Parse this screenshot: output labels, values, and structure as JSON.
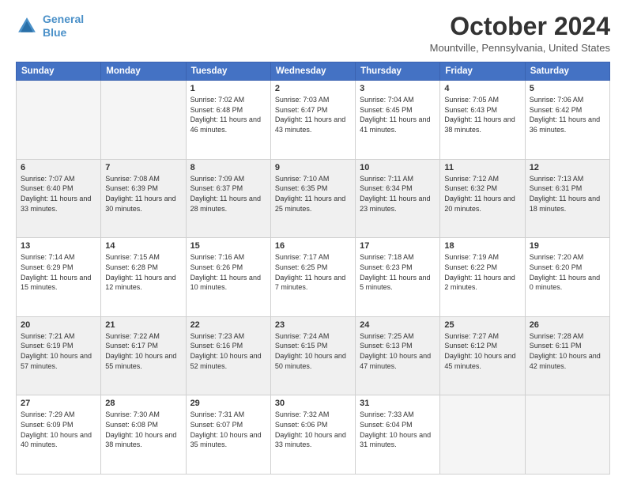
{
  "header": {
    "logo_line1": "General",
    "logo_line2": "Blue",
    "month_title": "October 2024",
    "location": "Mountville, Pennsylvania, United States"
  },
  "days_of_week": [
    "Sunday",
    "Monday",
    "Tuesday",
    "Wednesday",
    "Thursday",
    "Friday",
    "Saturday"
  ],
  "weeks": [
    [
      {
        "day": "",
        "info": ""
      },
      {
        "day": "",
        "info": ""
      },
      {
        "day": "1",
        "info": "Sunrise: 7:02 AM\nSunset: 6:48 PM\nDaylight: 11 hours and 46 minutes."
      },
      {
        "day": "2",
        "info": "Sunrise: 7:03 AM\nSunset: 6:47 PM\nDaylight: 11 hours and 43 minutes."
      },
      {
        "day": "3",
        "info": "Sunrise: 7:04 AM\nSunset: 6:45 PM\nDaylight: 11 hours and 41 minutes."
      },
      {
        "day": "4",
        "info": "Sunrise: 7:05 AM\nSunset: 6:43 PM\nDaylight: 11 hours and 38 minutes."
      },
      {
        "day": "5",
        "info": "Sunrise: 7:06 AM\nSunset: 6:42 PM\nDaylight: 11 hours and 36 minutes."
      }
    ],
    [
      {
        "day": "6",
        "info": "Sunrise: 7:07 AM\nSunset: 6:40 PM\nDaylight: 11 hours and 33 minutes."
      },
      {
        "day": "7",
        "info": "Sunrise: 7:08 AM\nSunset: 6:39 PM\nDaylight: 11 hours and 30 minutes."
      },
      {
        "day": "8",
        "info": "Sunrise: 7:09 AM\nSunset: 6:37 PM\nDaylight: 11 hours and 28 minutes."
      },
      {
        "day": "9",
        "info": "Sunrise: 7:10 AM\nSunset: 6:35 PM\nDaylight: 11 hours and 25 minutes."
      },
      {
        "day": "10",
        "info": "Sunrise: 7:11 AM\nSunset: 6:34 PM\nDaylight: 11 hours and 23 minutes."
      },
      {
        "day": "11",
        "info": "Sunrise: 7:12 AM\nSunset: 6:32 PM\nDaylight: 11 hours and 20 minutes."
      },
      {
        "day": "12",
        "info": "Sunrise: 7:13 AM\nSunset: 6:31 PM\nDaylight: 11 hours and 18 minutes."
      }
    ],
    [
      {
        "day": "13",
        "info": "Sunrise: 7:14 AM\nSunset: 6:29 PM\nDaylight: 11 hours and 15 minutes."
      },
      {
        "day": "14",
        "info": "Sunrise: 7:15 AM\nSunset: 6:28 PM\nDaylight: 11 hours and 12 minutes."
      },
      {
        "day": "15",
        "info": "Sunrise: 7:16 AM\nSunset: 6:26 PM\nDaylight: 11 hours and 10 minutes."
      },
      {
        "day": "16",
        "info": "Sunrise: 7:17 AM\nSunset: 6:25 PM\nDaylight: 11 hours and 7 minutes."
      },
      {
        "day": "17",
        "info": "Sunrise: 7:18 AM\nSunset: 6:23 PM\nDaylight: 11 hours and 5 minutes."
      },
      {
        "day": "18",
        "info": "Sunrise: 7:19 AM\nSunset: 6:22 PM\nDaylight: 11 hours and 2 minutes."
      },
      {
        "day": "19",
        "info": "Sunrise: 7:20 AM\nSunset: 6:20 PM\nDaylight: 11 hours and 0 minutes."
      }
    ],
    [
      {
        "day": "20",
        "info": "Sunrise: 7:21 AM\nSunset: 6:19 PM\nDaylight: 10 hours and 57 minutes."
      },
      {
        "day": "21",
        "info": "Sunrise: 7:22 AM\nSunset: 6:17 PM\nDaylight: 10 hours and 55 minutes."
      },
      {
        "day": "22",
        "info": "Sunrise: 7:23 AM\nSunset: 6:16 PM\nDaylight: 10 hours and 52 minutes."
      },
      {
        "day": "23",
        "info": "Sunrise: 7:24 AM\nSunset: 6:15 PM\nDaylight: 10 hours and 50 minutes."
      },
      {
        "day": "24",
        "info": "Sunrise: 7:25 AM\nSunset: 6:13 PM\nDaylight: 10 hours and 47 minutes."
      },
      {
        "day": "25",
        "info": "Sunrise: 7:27 AM\nSunset: 6:12 PM\nDaylight: 10 hours and 45 minutes."
      },
      {
        "day": "26",
        "info": "Sunrise: 7:28 AM\nSunset: 6:11 PM\nDaylight: 10 hours and 42 minutes."
      }
    ],
    [
      {
        "day": "27",
        "info": "Sunrise: 7:29 AM\nSunset: 6:09 PM\nDaylight: 10 hours and 40 minutes."
      },
      {
        "day": "28",
        "info": "Sunrise: 7:30 AM\nSunset: 6:08 PM\nDaylight: 10 hours and 38 minutes."
      },
      {
        "day": "29",
        "info": "Sunrise: 7:31 AM\nSunset: 6:07 PM\nDaylight: 10 hours and 35 minutes."
      },
      {
        "day": "30",
        "info": "Sunrise: 7:32 AM\nSunset: 6:06 PM\nDaylight: 10 hours and 33 minutes."
      },
      {
        "day": "31",
        "info": "Sunrise: 7:33 AM\nSunset: 6:04 PM\nDaylight: 10 hours and 31 minutes."
      },
      {
        "day": "",
        "info": ""
      },
      {
        "day": "",
        "info": ""
      }
    ]
  ]
}
